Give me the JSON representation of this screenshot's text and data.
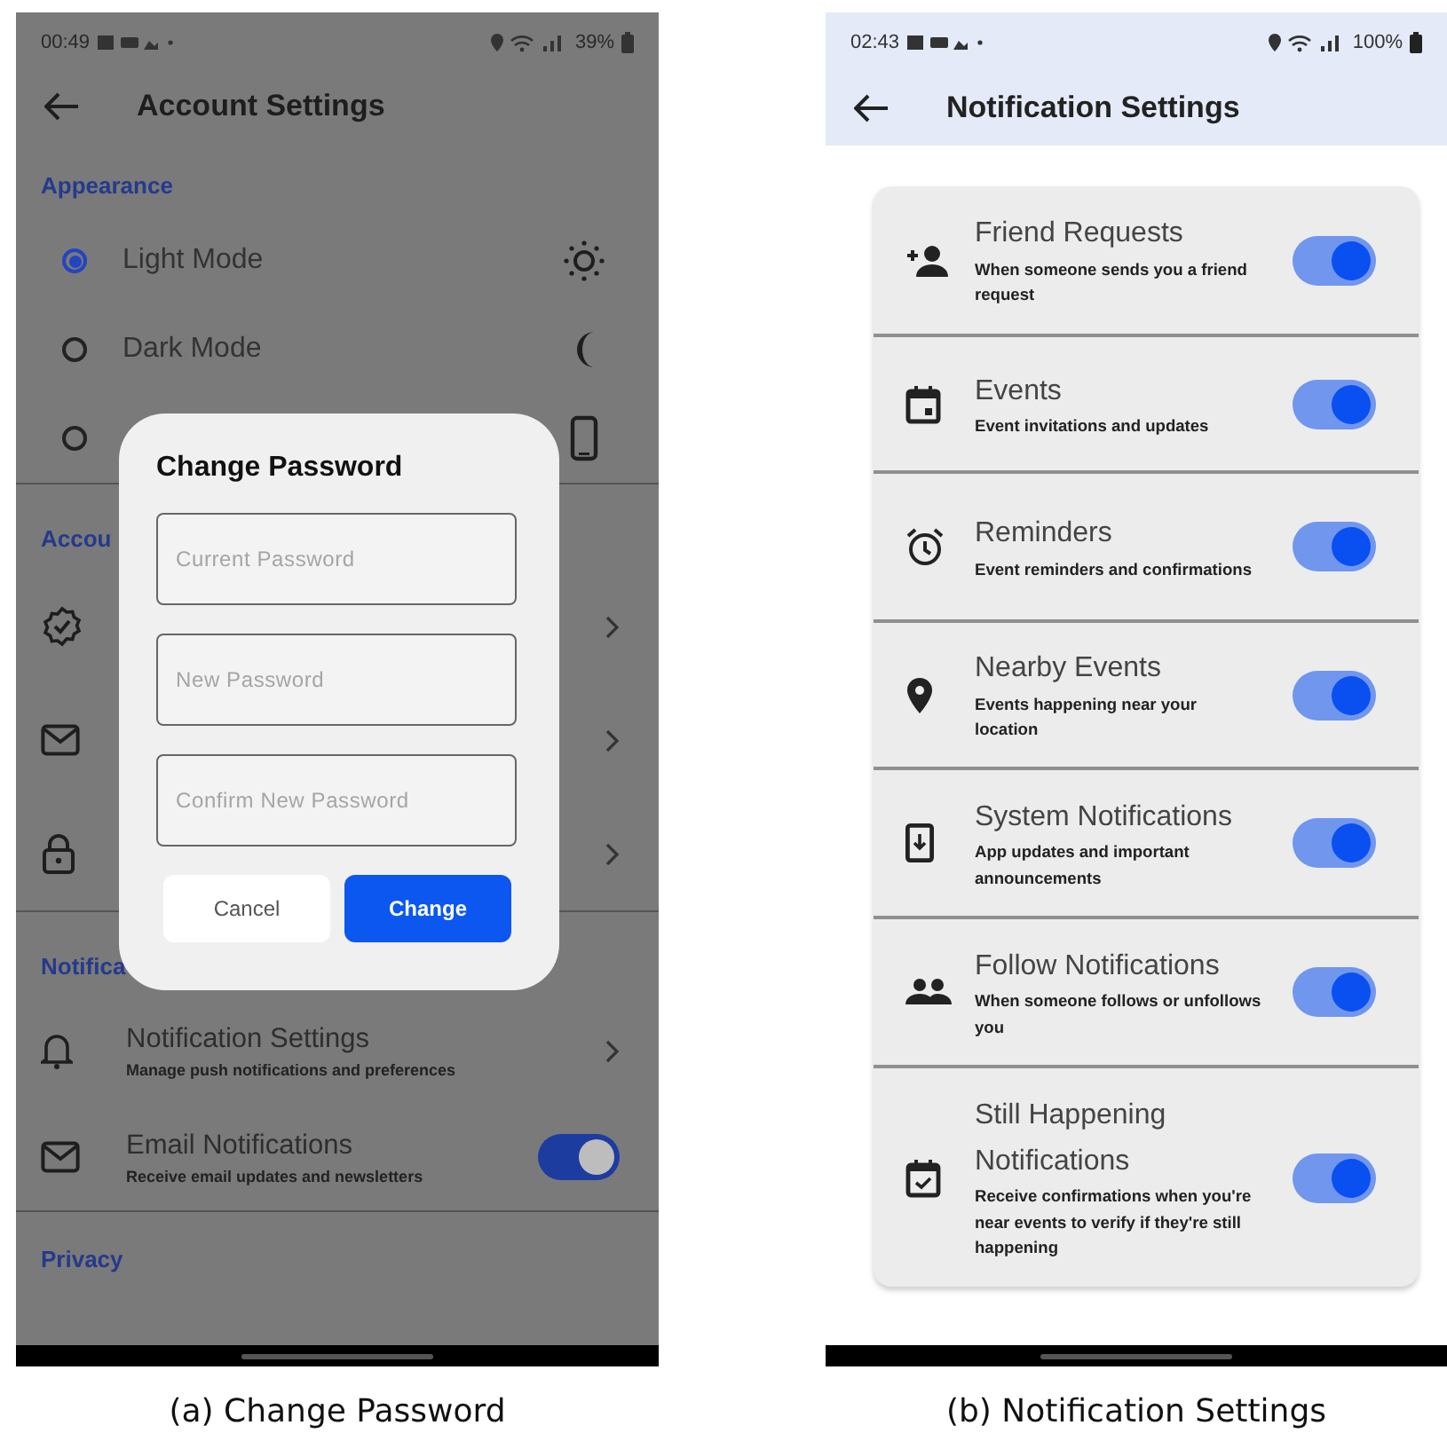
{
  "change_password_screen": {
    "status_bar": {
      "time": "00:49",
      "battery": "39%"
    },
    "app_bar": {
      "title": "Account Settings"
    },
    "sections": [
      {
        "header": "Appearance",
        "rows": [
          {
            "kind": "radio",
            "label": "Light Mode",
            "selected": true
          },
          {
            "kind": "radio",
            "label": "Dark Mode",
            "selected": false
          },
          {
            "kind": "radio",
            "selected": false
          }
        ]
      },
      {
        "header": "Accou",
        "rows": [
          {
            "kind": "link"
          },
          {
            "kind": "link"
          },
          {
            "kind": "link"
          }
        ]
      },
      {
        "header": "Notifica",
        "rows": [
          {
            "kind": "link",
            "title": "Notification Settings",
            "subtitle": "Manage push notifications and preferences"
          },
          {
            "kind": "toggle",
            "title": "Email Notifications",
            "subtitle": "Receive email updates and newsletters",
            "on": true
          }
        ]
      },
      {
        "header": "Privacy"
      }
    ],
    "dialog": {
      "title": "Change Password",
      "fields": [
        {
          "placeholder": "Current Password"
        },
        {
          "placeholder": "New Password"
        },
        {
          "placeholder": "Confirm New Password"
        }
      ],
      "buttons": [
        {
          "label": "Cancel",
          "kind": "secondary"
        },
        {
          "label": "Change",
          "kind": "primary"
        }
      ]
    },
    "caption": "(a) Change Password"
  },
  "notification_settings_screen": {
    "status_bar": {
      "time": "02:43",
      "battery": "100%"
    },
    "app_bar": {
      "title": "Notification Settings"
    },
    "settings": [
      {
        "title": "Friend Requests",
        "subtitle": "When someone sends you a friend request",
        "on": true
      },
      {
        "title": "Events",
        "subtitle": "Event invitations and updates",
        "on": true
      },
      {
        "title": "Reminders",
        "subtitle": "Event reminders and confirmations",
        "on": true
      },
      {
        "title": "Nearby Events",
        "subtitle": "Events happening near your location",
        "on": true
      },
      {
        "title": "System Notifications",
        "subtitle": "App updates and important announcements",
        "on": true
      },
      {
        "title": "Follow Notifications",
        "subtitle": "When someone follows or unfollows you",
        "on": true
      },
      {
        "title": "Still Happening Notifications",
        "subtitle": "Receive confirmations when you're near events to verify if they're still happening",
        "on": true
      }
    ],
    "caption": "(b) Notification Settings"
  }
}
